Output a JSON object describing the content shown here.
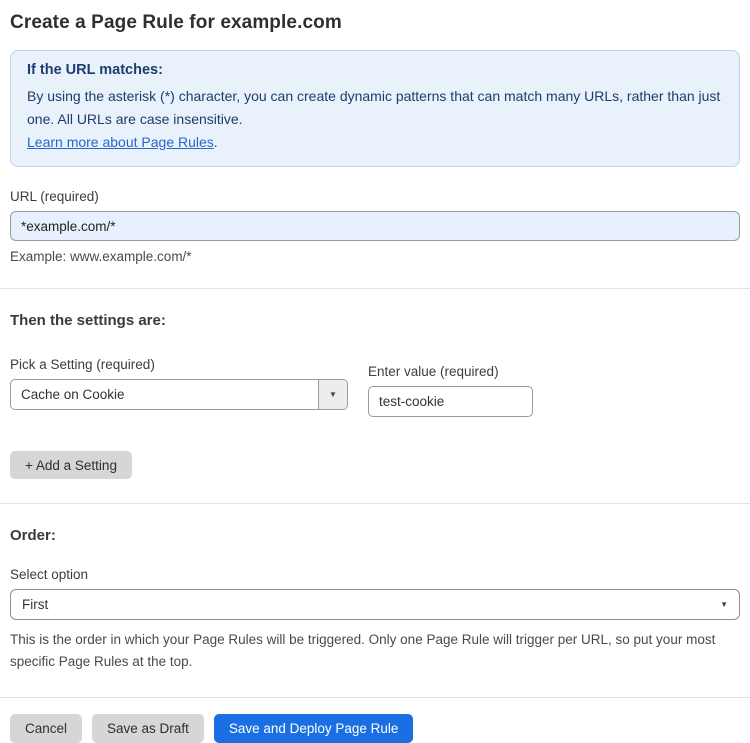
{
  "page": {
    "title": "Create a Page Rule for example.com"
  },
  "info_box": {
    "heading": "If the URL matches:",
    "body": "By using the asterisk (*) character, you can create dynamic patterns that can match many URLs, rather than just one. All URLs are case insensitive.",
    "link_label": "Learn more about Page Rules",
    "link_suffix": "."
  },
  "url_field": {
    "label": "URL (required)",
    "value": "*example.com/*",
    "example": "Example: www.example.com/*"
  },
  "settings_section": {
    "heading": "Then the settings are:",
    "setting_label": "Pick a Setting (required)",
    "setting_value": "Cache on Cookie",
    "value_label": "Enter value (required)",
    "value_value": "test-cookie",
    "add_setting_label": "+ Add a Setting"
  },
  "order_section": {
    "heading": "Order:",
    "select_label": "Select option",
    "select_value": "First",
    "help_text": "This is the order in which your Page Rules will be triggered. Only one Page Rule will trigger per URL, so put your most specific Page Rules at the top."
  },
  "footer": {
    "cancel_label": "Cancel",
    "save_draft_label": "Save as Draft",
    "save_deploy_label": "Save and Deploy Page Rule"
  },
  "icons": {
    "dropdown_caret": "▼"
  },
  "colors": {
    "info_bg": "#e9f1fb",
    "info_border": "#b9d3f0",
    "info_text": "#1e3c6e",
    "link_blue": "#2966c9",
    "url_input_bg": "#e8f0fe",
    "primary_button": "#1a70e3",
    "gray_button": "#d6d6d6"
  }
}
